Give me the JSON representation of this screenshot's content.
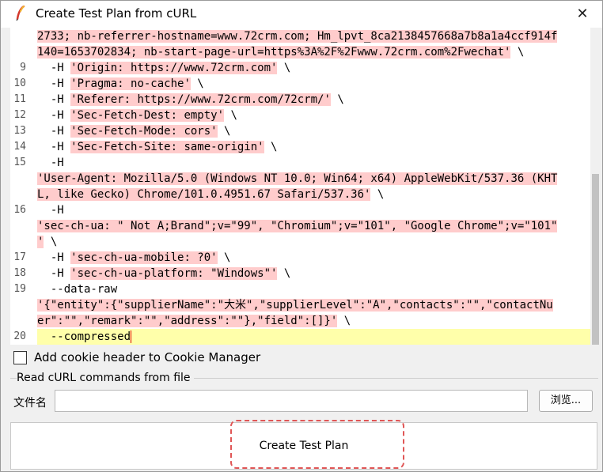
{
  "window": {
    "title": "Create Test Plan from cURL",
    "close_glyph": "✕"
  },
  "editor": {
    "lines": [
      {
        "num": "",
        "pre": "",
        "str": "2733; nb-referrer-hostname=www.72crm.com; Hm_lpvt_8ca2138457668a7b8a1a4ccf914f",
        "post": ""
      },
      {
        "num": "",
        "pre": "",
        "str": "140=1653702834; nb-start-page-url=https%3A%2F%2Fwww.72crm.com%2Fwechat'",
        "post": " \\"
      },
      {
        "num": "9",
        "pre": "  -H ",
        "str": "'Origin: https://www.72crm.com'",
        "post": " \\"
      },
      {
        "num": "10",
        "pre": "  -H ",
        "str": "'Pragma: no-cache'",
        "post": " \\"
      },
      {
        "num": "11",
        "pre": "  -H ",
        "str": "'Referer: https://www.72crm.com/72crm/'",
        "post": " \\"
      },
      {
        "num": "12",
        "pre": "  -H ",
        "str": "'Sec-Fetch-Dest: empty'",
        "post": " \\"
      },
      {
        "num": "13",
        "pre": "  -H ",
        "str": "'Sec-Fetch-Mode: cors'",
        "post": " \\"
      },
      {
        "num": "14",
        "pre": "  -H ",
        "str": "'Sec-Fetch-Site: same-origin'",
        "post": " \\"
      },
      {
        "num": "15",
        "pre": "  -H",
        "str": "",
        "post": ""
      },
      {
        "num": "",
        "pre": "",
        "str": "'User-Agent: Mozilla/5.0 (Windows NT 10.0; Win64; x64) AppleWebKit/537.36 (KHT",
        "post": ""
      },
      {
        "num": "",
        "pre": "",
        "str": "L, like Gecko) Chrome/101.0.4951.67 Safari/537.36'",
        "post": " \\"
      },
      {
        "num": "16",
        "pre": "  -H",
        "str": "",
        "post": ""
      },
      {
        "num": "",
        "pre": "",
        "str": "'sec-ch-ua: \" Not A;Brand\";v=\"99\", \"Chromium\";v=\"101\", \"Google Chrome\";v=\"101\"",
        "post": ""
      },
      {
        "num": "",
        "pre": "",
        "str": "'",
        "post": " \\"
      },
      {
        "num": "17",
        "pre": "  -H ",
        "str": "'sec-ch-ua-mobile: ?0'",
        "post": " \\"
      },
      {
        "num": "18",
        "pre": "  -H ",
        "str": "'sec-ch-ua-platform: \"Windows\"'",
        "post": " \\"
      },
      {
        "num": "19",
        "pre": "  --data-raw",
        "str": "",
        "post": ""
      },
      {
        "num": "",
        "pre": "",
        "str": "'{\"entity\":{\"supplierName\":\"大米\",\"supplierLevel\":\"A\",\"contacts\":\"\",\"contactNu",
        "post": ""
      },
      {
        "num": "",
        "pre": "",
        "str": "er\":\"\",\"remark\":\"\",\"address\":\"\"},\"field\":[]}'",
        "post": " \\"
      },
      {
        "num": "20",
        "pre": "  --compressed",
        "str": "",
        "post": ""
      }
    ]
  },
  "options": {
    "cookie_label": "Add cookie header to Cookie Manager"
  },
  "file_section": {
    "title": "Read cURL commands from file",
    "file_label": "文件名",
    "file_value": "",
    "browse_label": "浏览..."
  },
  "actions": {
    "create_label": "Create Test Plan"
  }
}
